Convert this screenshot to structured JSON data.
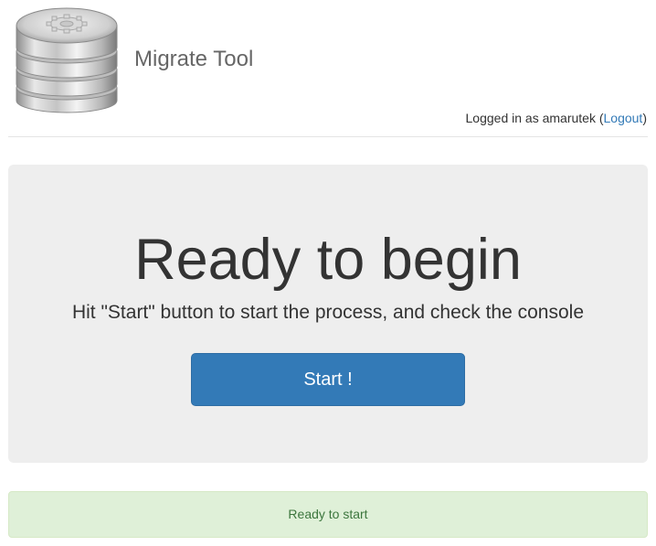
{
  "header": {
    "app_title": "Migrate Tool",
    "logo_icon": "database-stack-icon",
    "login": {
      "prefix": "Logged in as amarutek (",
      "logout_label": "Logout",
      "suffix": ")"
    }
  },
  "main": {
    "title": "Ready to begin",
    "subtitle": "Hit \"Start\" button to start the process, and check the console",
    "start_button_label": "Start !"
  },
  "status": {
    "message": "Ready to start"
  },
  "colors": {
    "primary": "#337ab7",
    "jumbotron_bg": "#eeeeee",
    "success_bg": "#dff0d8",
    "success_text": "#3c763d",
    "link": "#337ab7"
  }
}
